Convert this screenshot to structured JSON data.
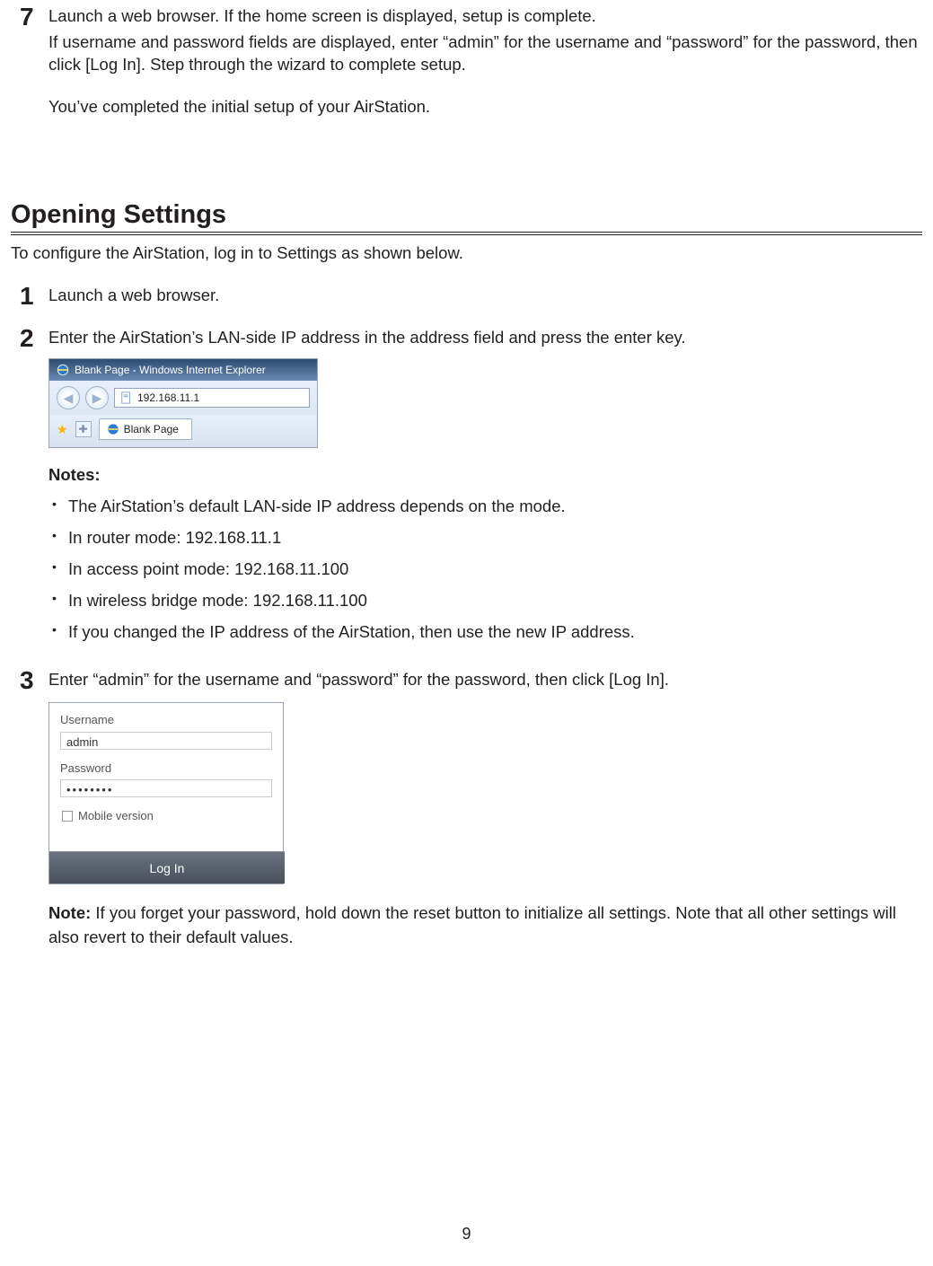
{
  "step7": {
    "num": "7",
    "p1": "Launch a web browser. If the home screen is displayed, setup is complete.",
    "p2": "If username and password fields are displayed, enter “admin” for the username and “password” for the password, then click [Log In]. Step through the wizard to complete setup.",
    "p3": "You’ve completed the initial setup of your AirStation."
  },
  "sectionTitle": "Opening Settings",
  "intro": "To configure the AirStation, log in to Settings as shown below.",
  "step1": {
    "num": "1",
    "text": "Launch a web browser."
  },
  "step2": {
    "num": "2",
    "text": "Enter the AirStation’s LAN-side IP address in the address field and press the enter key."
  },
  "ie": {
    "title": "Blank Page - Windows Internet Explorer",
    "address": "192.168.11.1",
    "tab": "Blank Page"
  },
  "notes": {
    "label": "Notes:",
    "items": [
      "The AirStation’s default LAN-side IP address depends on the mode.",
      "In router mode:  192.168.11.1",
      "In access point mode:  192.168.11.100",
      "In wireless bridge mode:  192.168.11.100",
      "If you changed the IP address of the AirStation, then use the new IP address."
    ]
  },
  "step3": {
    "num": "3",
    "text": "Enter “admin” for the username and “password” for the password, then click [Log In]."
  },
  "login": {
    "usernameLabel": "Username",
    "usernameValue": "admin",
    "passwordLabel": "Password",
    "passwordValue": "••••••••",
    "mobileLabel": "Mobile version",
    "button": "Log In"
  },
  "footNote": {
    "label": "Note:",
    "text": " If you forget your password, hold down the reset button to initialize all settings. Note that all other settings will also revert to their default values."
  },
  "pageNumber": "9"
}
